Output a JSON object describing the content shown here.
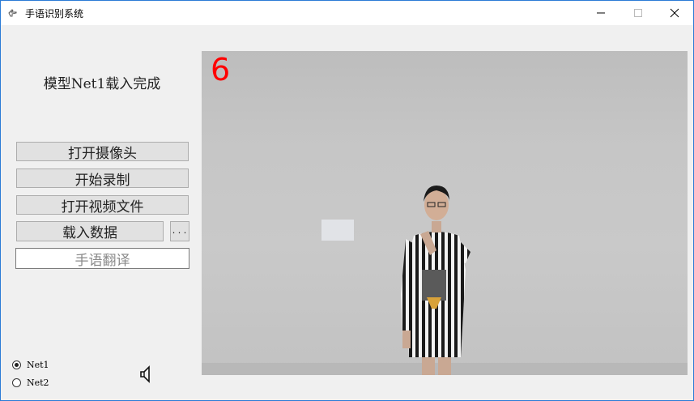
{
  "window": {
    "title": "手语识别系统",
    "controls": {
      "minimize": "minimize-icon",
      "maximize": "maximize-icon",
      "close": "close-icon"
    }
  },
  "left_panel": {
    "status": "模型Net1载入完成",
    "buttons": {
      "open_camera": "打开摄像头",
      "start_record": "开始录制",
      "open_video": "打开视频文件",
      "load_data": "载入数据",
      "browse": "..."
    },
    "translation_output": "手语翻译",
    "model_options": [
      {
        "label": "Net1",
        "selected": true
      },
      {
        "label": "Net2",
        "selected": false
      }
    ],
    "speaker_icon": "speaker-icon"
  },
  "video": {
    "frame_number": "6",
    "frame_number_color": "#ff0000"
  }
}
